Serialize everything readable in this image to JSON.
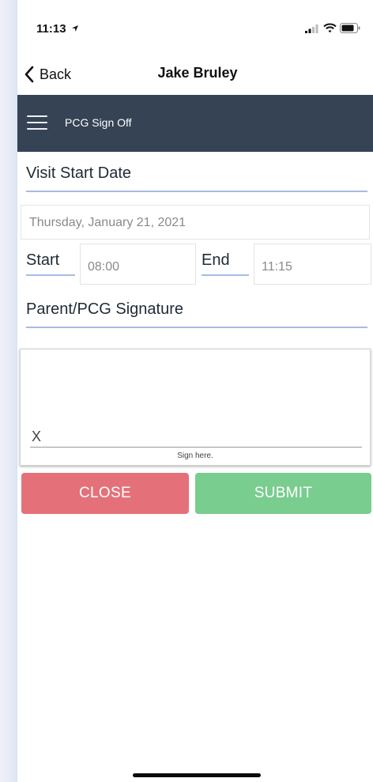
{
  "status_bar": {
    "time": "11:13",
    "icons": [
      "location-arrow-icon",
      "signal-icon",
      "wifi-icon",
      "battery-icon"
    ]
  },
  "nav_bar": {
    "back_label": "Back",
    "title": "Jake Bruley"
  },
  "app_bar": {
    "title": "PCG Sign Off",
    "menu_icon": "hamburger-menu-icon",
    "background_color": "#354355"
  },
  "visit": {
    "start_date_label": "Visit Start Date",
    "start_date_value": "Thursday, January 21, 2021",
    "start_label": "Start",
    "start_time": "08:00",
    "end_label": "End",
    "end_time": "11:15"
  },
  "signature": {
    "label": "Parent/PCG Signature",
    "x_mark": "X",
    "hint": "Sign here."
  },
  "actions": {
    "close_label": "CLOSE",
    "close_color": "#e4717a",
    "submit_label": "SUBMIT",
    "submit_color": "#79cd8e"
  }
}
